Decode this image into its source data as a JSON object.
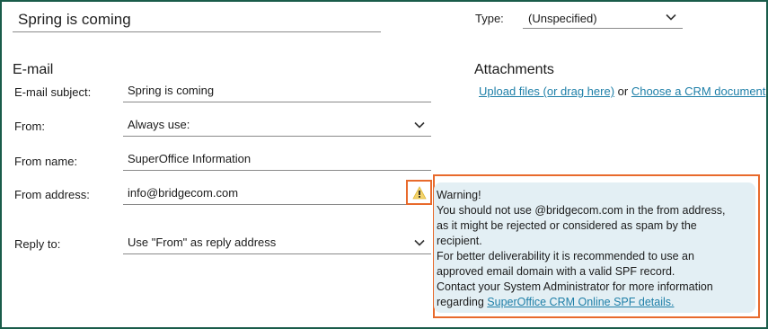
{
  "header": {
    "title_value": "Spring is coming",
    "type_label": "Type:",
    "type_value": "(Unspecified)"
  },
  "email": {
    "heading": "E-mail",
    "subject_label": "E-mail subject:",
    "subject_value": "Spring is coming",
    "from_label": "From:",
    "from_value": "Always use:",
    "from_name_label": "From name:",
    "from_name_value": "SuperOffice Information",
    "from_address_label": "From address:",
    "from_address_value": "info@bridgecom.com",
    "reply_to_label": "Reply to:",
    "reply_to_value": "Use \"From\" as reply address"
  },
  "attachments": {
    "heading": "Attachments",
    "upload_link": "Upload files (or drag here)",
    "or_text": " or ",
    "crm_link": "Choose a CRM document"
  },
  "warning": {
    "title": "Warning!",
    "line1": "You should not use @bridgecom.com in the from address,",
    "line2": "as it might be rejected or considered as spam by the",
    "line3": "recipient.",
    "line4": "For better deliverability it is recommended to use an",
    "line5": "approved email domain with a valid SPF record.",
    "line6": "Contact your System Administrator for more information",
    "line7_prefix": "regarding ",
    "spf_link": "SuperOffice CRM Online SPF details.",
    "icon": "warning-triangle-icon",
    "accent_color": "#e86a2c",
    "bubble_color": "#e3eff4"
  },
  "colors": {
    "frame": "#1a5c4a",
    "link": "#1e7fa8"
  }
}
